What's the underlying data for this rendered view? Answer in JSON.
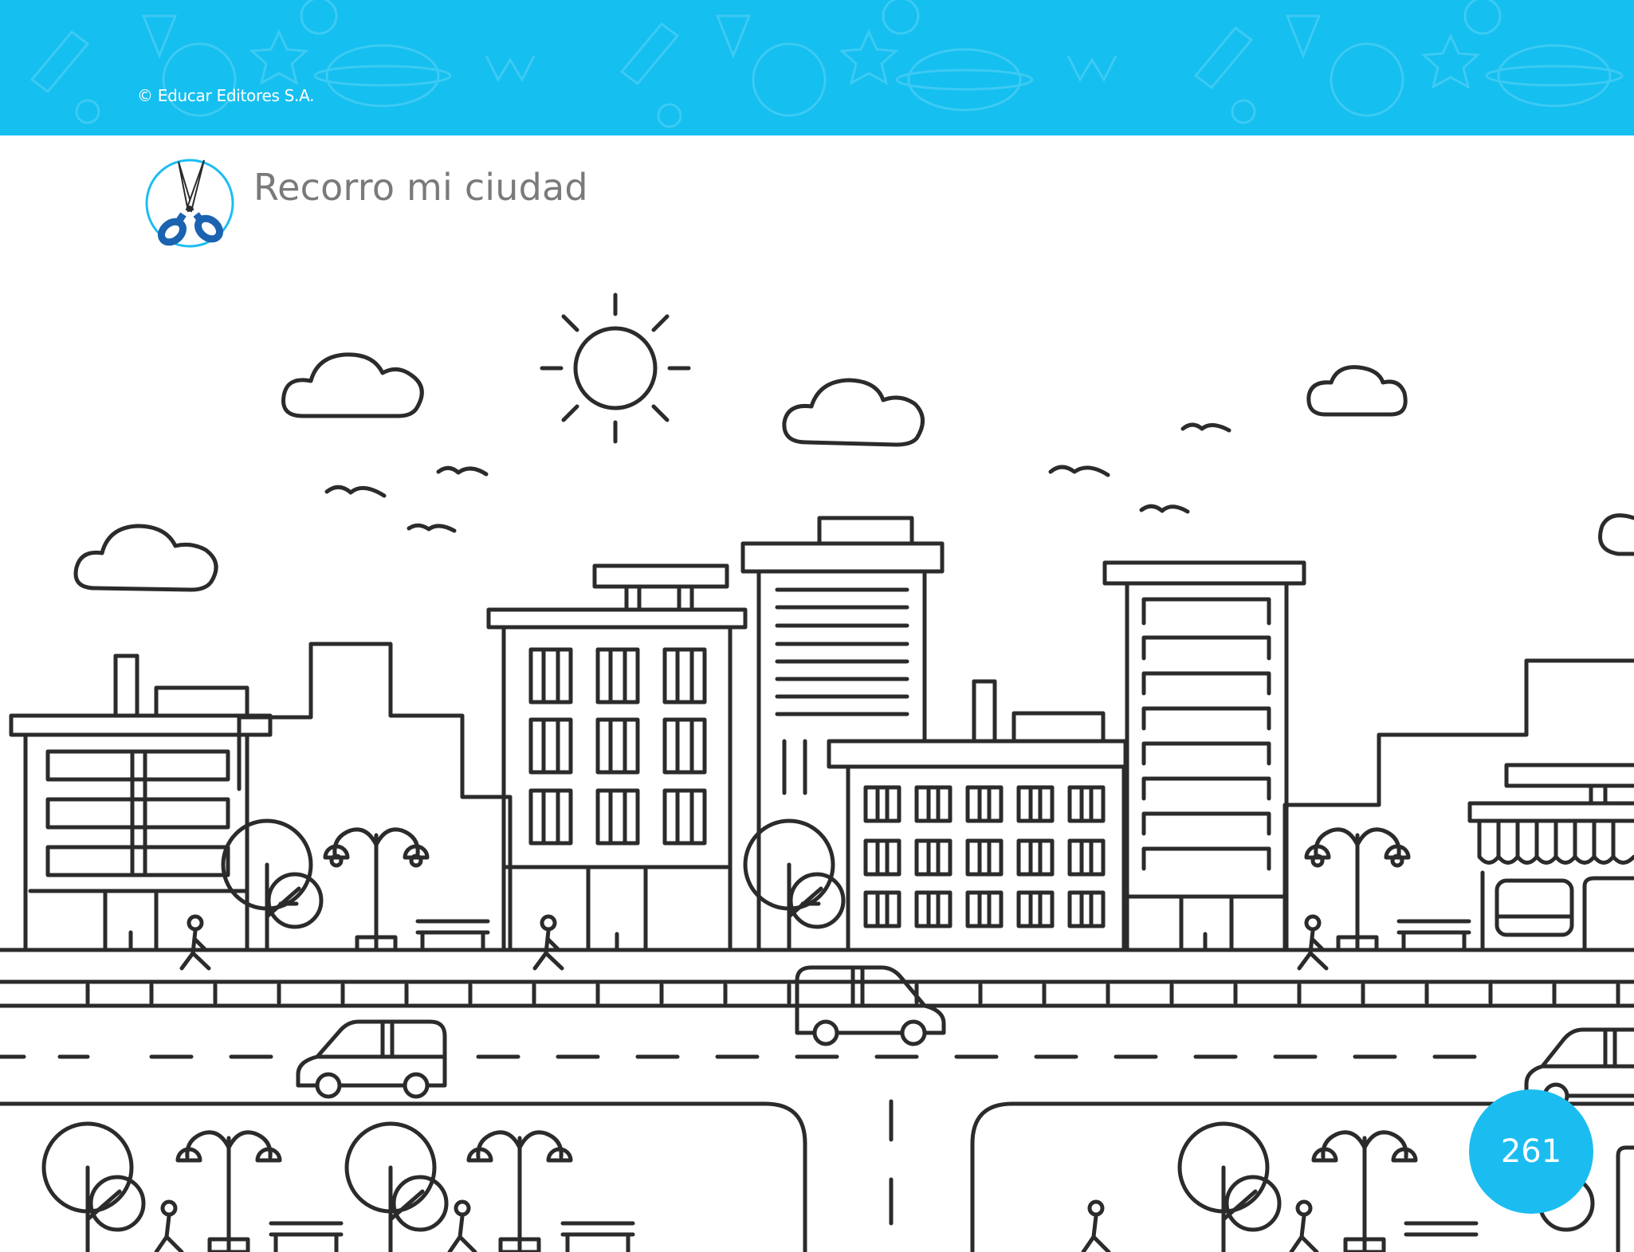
{
  "header": {
    "copyright": "© Educar Editores S.A.",
    "title": "Recorro mi ciudad",
    "activity_icon": "scissors-icon"
  },
  "footer": {
    "page_number": "261"
  },
  "colors": {
    "banner": "#15bff0",
    "banner_pattern": "#3ccaf3",
    "ink": "#2b2b2b",
    "page_badge": "#1bbdf0",
    "scissors_handles": "#1b63b0",
    "title_text": "#7a7a7a"
  },
  "illustration": {
    "subject": "city-street-coloring-page"
  }
}
